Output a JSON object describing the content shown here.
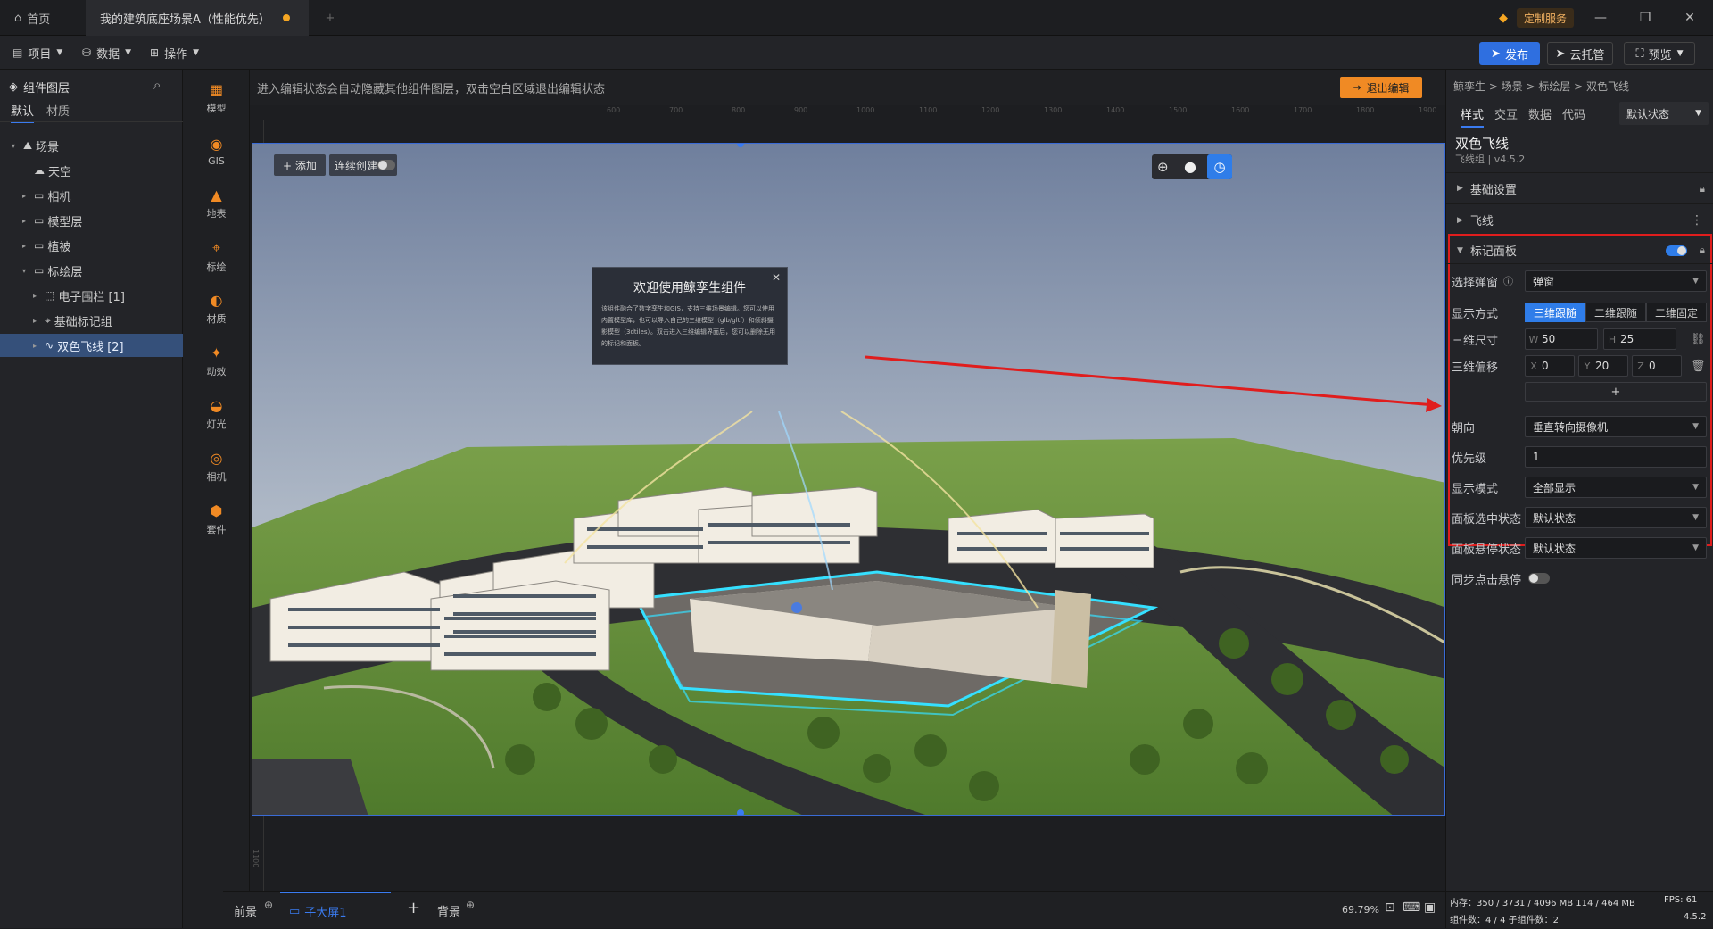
{
  "titlebar": {
    "home_label": "首页",
    "doc_tab": "我的建筑底座场景A（性能优先）",
    "new_tab": "+",
    "custom_service": "定制服务"
  },
  "menubar": {
    "project": "项目",
    "data": "数据",
    "ops": "操作",
    "publish": "发布",
    "cloud": "云托管",
    "preview": "预览"
  },
  "left": {
    "title": "组件图层",
    "tabs": [
      "默认",
      "材质"
    ],
    "tree": [
      {
        "label": "场景",
        "level": 0,
        "arrow": "▾",
        "icon": "⛰"
      },
      {
        "label": "天空",
        "level": 1,
        "arrow": "",
        "icon": "☁"
      },
      {
        "label": "相机",
        "level": 1,
        "arrow": "▸",
        "icon": "▭"
      },
      {
        "label": "模型层",
        "level": 1,
        "arrow": "▸",
        "icon": "▭"
      },
      {
        "label": "植被",
        "level": 1,
        "arrow": "▸",
        "icon": "▭"
      },
      {
        "label": "标绘层",
        "level": 1,
        "arrow": "▾",
        "icon": "▭"
      },
      {
        "label": "电子围栏 [1]",
        "level": 2,
        "arrow": "▸",
        "icon": "⬚"
      },
      {
        "label": "基础标记组",
        "level": 2,
        "arrow": "▸",
        "icon": "⌖"
      },
      {
        "label": "双色飞线 [2]",
        "level": 2,
        "arrow": "▸",
        "icon": "∿"
      }
    ]
  },
  "iconbar": [
    "模型",
    "GIS",
    "地表",
    "标绘",
    "材质",
    "动效",
    "灯光",
    "相机",
    "套件"
  ],
  "canvas": {
    "hint": "进入编辑状态会自动隐藏其他组件图层，双击空白区域退出编辑状态",
    "exit": "退出编辑",
    "add": "+ 添加",
    "continuous": "连续创建",
    "ruler_top": [
      "600",
      "700",
      "800",
      "900",
      "1000",
      "1100",
      "1200",
      "1300",
      "1400",
      "1500",
      "1600",
      "1700",
      "1800",
      "1900"
    ],
    "ruler_left": [
      "0",
      "100",
      "200",
      "300",
      "400",
      "500",
      "600",
      "700",
      "800",
      "900",
      "1000",
      "1100"
    ],
    "popup_title": "欢迎使用鲸孪生组件",
    "popup_body": "该组件融合了数字孪生和GIS，支持三维场景编辑。您可以使用内置模型库，也可以导入自己的三维模型（glb/gltf）和倾斜摄影模型（3dtiles）。双击进入三维编辑界面后，您可以删除无用的标记和面板。"
  },
  "bottom": {
    "front": "前景",
    "screen": "子大屏1",
    "back": "背景",
    "zoom": "69.79%"
  },
  "right": {
    "breadcrumb": "鲸孪生 > 场景 > 标绘层 > 双色飞线",
    "tabs": [
      "样式",
      "交互",
      "数据",
      "代码"
    ],
    "state": "默认状态",
    "comp_name": "双色飞线",
    "comp_sub": "飞线组 | v4.5.2",
    "sec_basic": "基础设置",
    "sec_fly": "飞线",
    "sec_marker": "标记面板",
    "popup_label": "选择弹窗",
    "popup_value": "弹窗",
    "display_label": "显示方式",
    "display_opts": [
      "三维跟随",
      "二维跟随",
      "二维固定"
    ],
    "size_label": "三维尺寸",
    "w": "50",
    "h": "25",
    "offset_label": "三维偏移",
    "x": "0",
    "y": "20",
    "z": "0",
    "plus": "+",
    "orient_label": "朝向",
    "orient_value": "垂直转向摄像机",
    "priority_label": "优先级",
    "priority_value": "1",
    "mode_label": "显示模式",
    "mode_value": "全部显示",
    "selected_label": "面板选中状态",
    "selected_value": "默认状态",
    "hover_label": "面板悬停状态",
    "hover_value": "默认状态",
    "sync_label": "同步点击悬停",
    "stats1": "内存：350 / 3731 / 4096 MB  114 / 464 MB",
    "fps": "FPS: 61",
    "stats2": "组件数：4 / 4  子组件数：2",
    "version": "4.5.2"
  }
}
